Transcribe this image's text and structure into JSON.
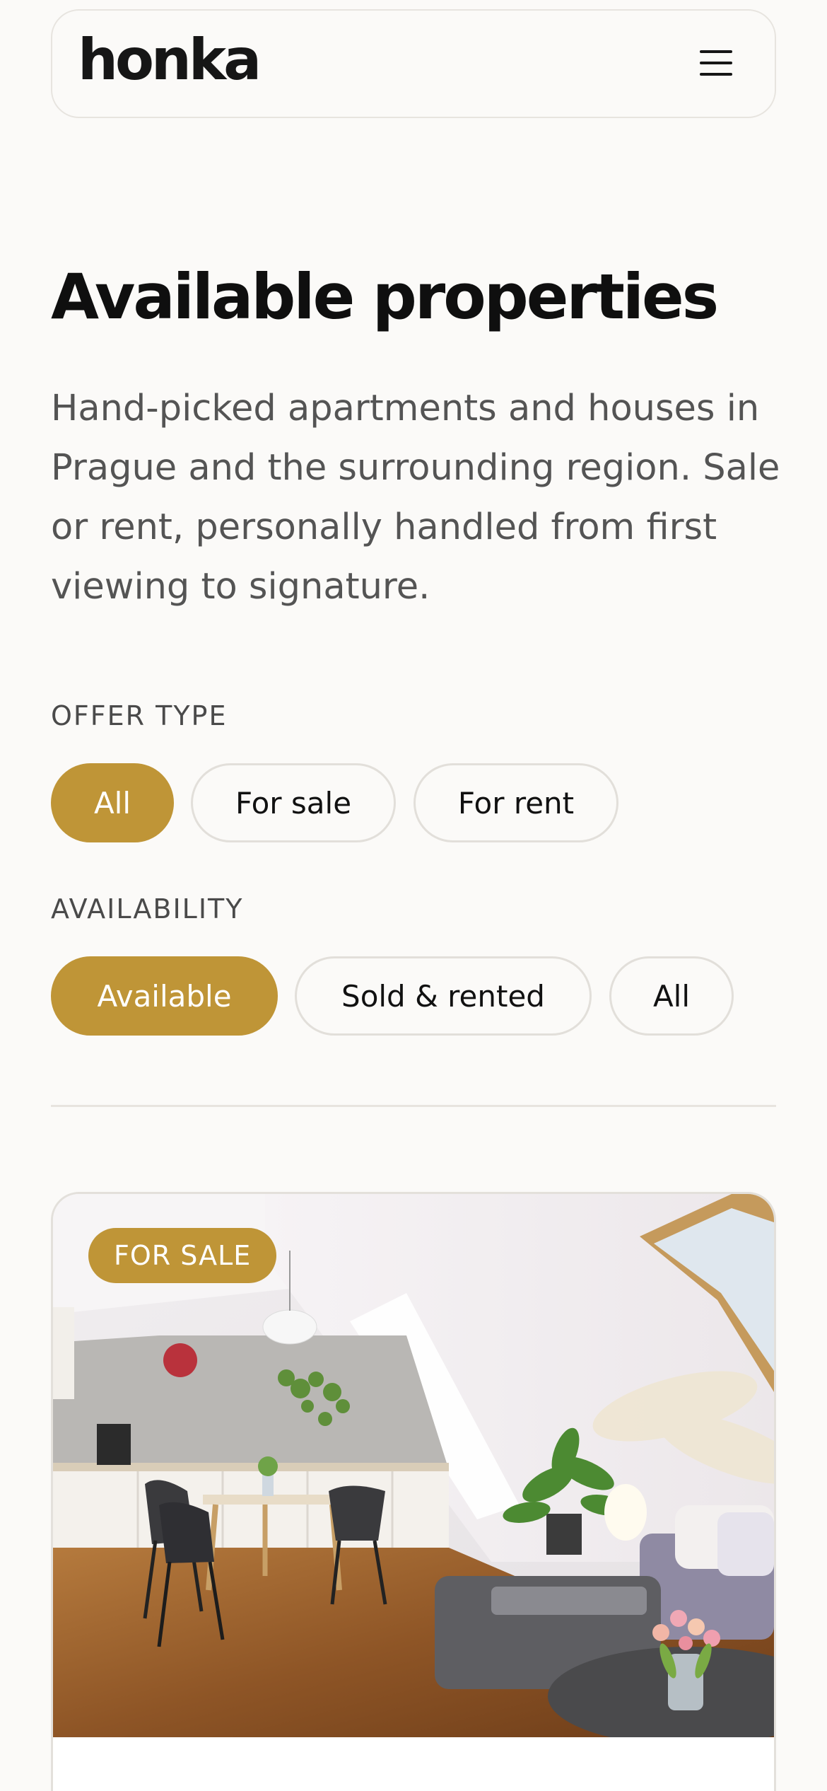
{
  "header": {
    "logo": "honka",
    "menu_icon": "hamburger-menu-icon"
  },
  "page": {
    "title": "Available properties",
    "intro": "Hand-picked apartments and houses in Prague and the surrounding region. Sale or rent, personally handled from first viewing to signature."
  },
  "filters": {
    "offer_type": {
      "label": "OFFER TYPE",
      "options": [
        "All",
        "For sale",
        "For rent"
      ],
      "selected": "All"
    },
    "availability": {
      "label": "AVAILABILITY",
      "options": [
        "Available",
        "Sold & rented",
        "All"
      ],
      "selected": "Available"
    }
  },
  "listings": [
    {
      "badge": "FOR SALE",
      "image": "attic-apartment-interior-photo"
    }
  ],
  "colors": {
    "accent": "#bf9537",
    "background": "#fbfaf8",
    "text": "#111111",
    "muted_text": "#545454",
    "border": "#e2dfda"
  }
}
